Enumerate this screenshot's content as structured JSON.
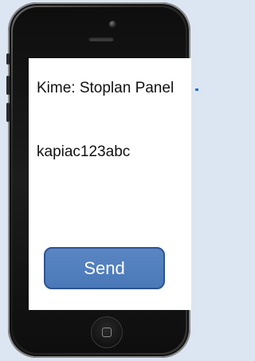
{
  "message": {
    "recipient": "Kime: Stoplan Panel",
    "body": "kapiac123abc"
  },
  "actions": {
    "send_label": "Send"
  },
  "colors": {
    "background": "#dce6f2",
    "send_button": "#4a78b8",
    "screen": "#ffffff"
  },
  "icons": {
    "home": "home-button-icon",
    "camera": "camera-icon",
    "earpiece": "earpiece-icon"
  }
}
